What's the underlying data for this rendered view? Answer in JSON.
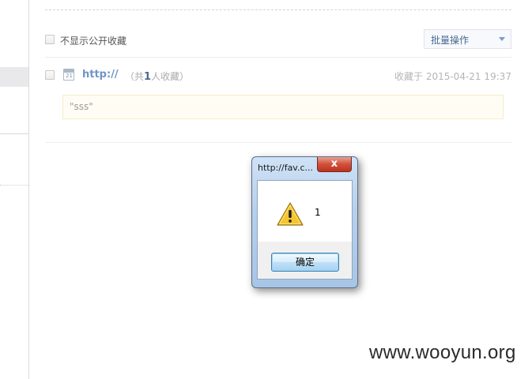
{
  "list": {
    "hide_public_label": "不显示公开收藏",
    "batch_label": "批量操作",
    "item": {
      "calendar_day": "21",
      "link": "http://",
      "count_prefix": "（共",
      "count": "1",
      "count_suffix": "人收藏）",
      "saved_at": "收藏于 2015-04-21 19:37",
      "note": "\"sss\""
    }
  },
  "dialog": {
    "title": "http://fav.c...",
    "close_symbol": "x",
    "message": "1",
    "ok_label": "确定"
  },
  "watermark": "www.wooyun.org",
  "colors": {
    "link": "#6e95c7",
    "accent": "#4a6a93",
    "note_bg": "#fffdf3"
  },
  "icons": [
    "calendar-icon",
    "warning-icon",
    "close-icon",
    "chevron-down-icon"
  ]
}
